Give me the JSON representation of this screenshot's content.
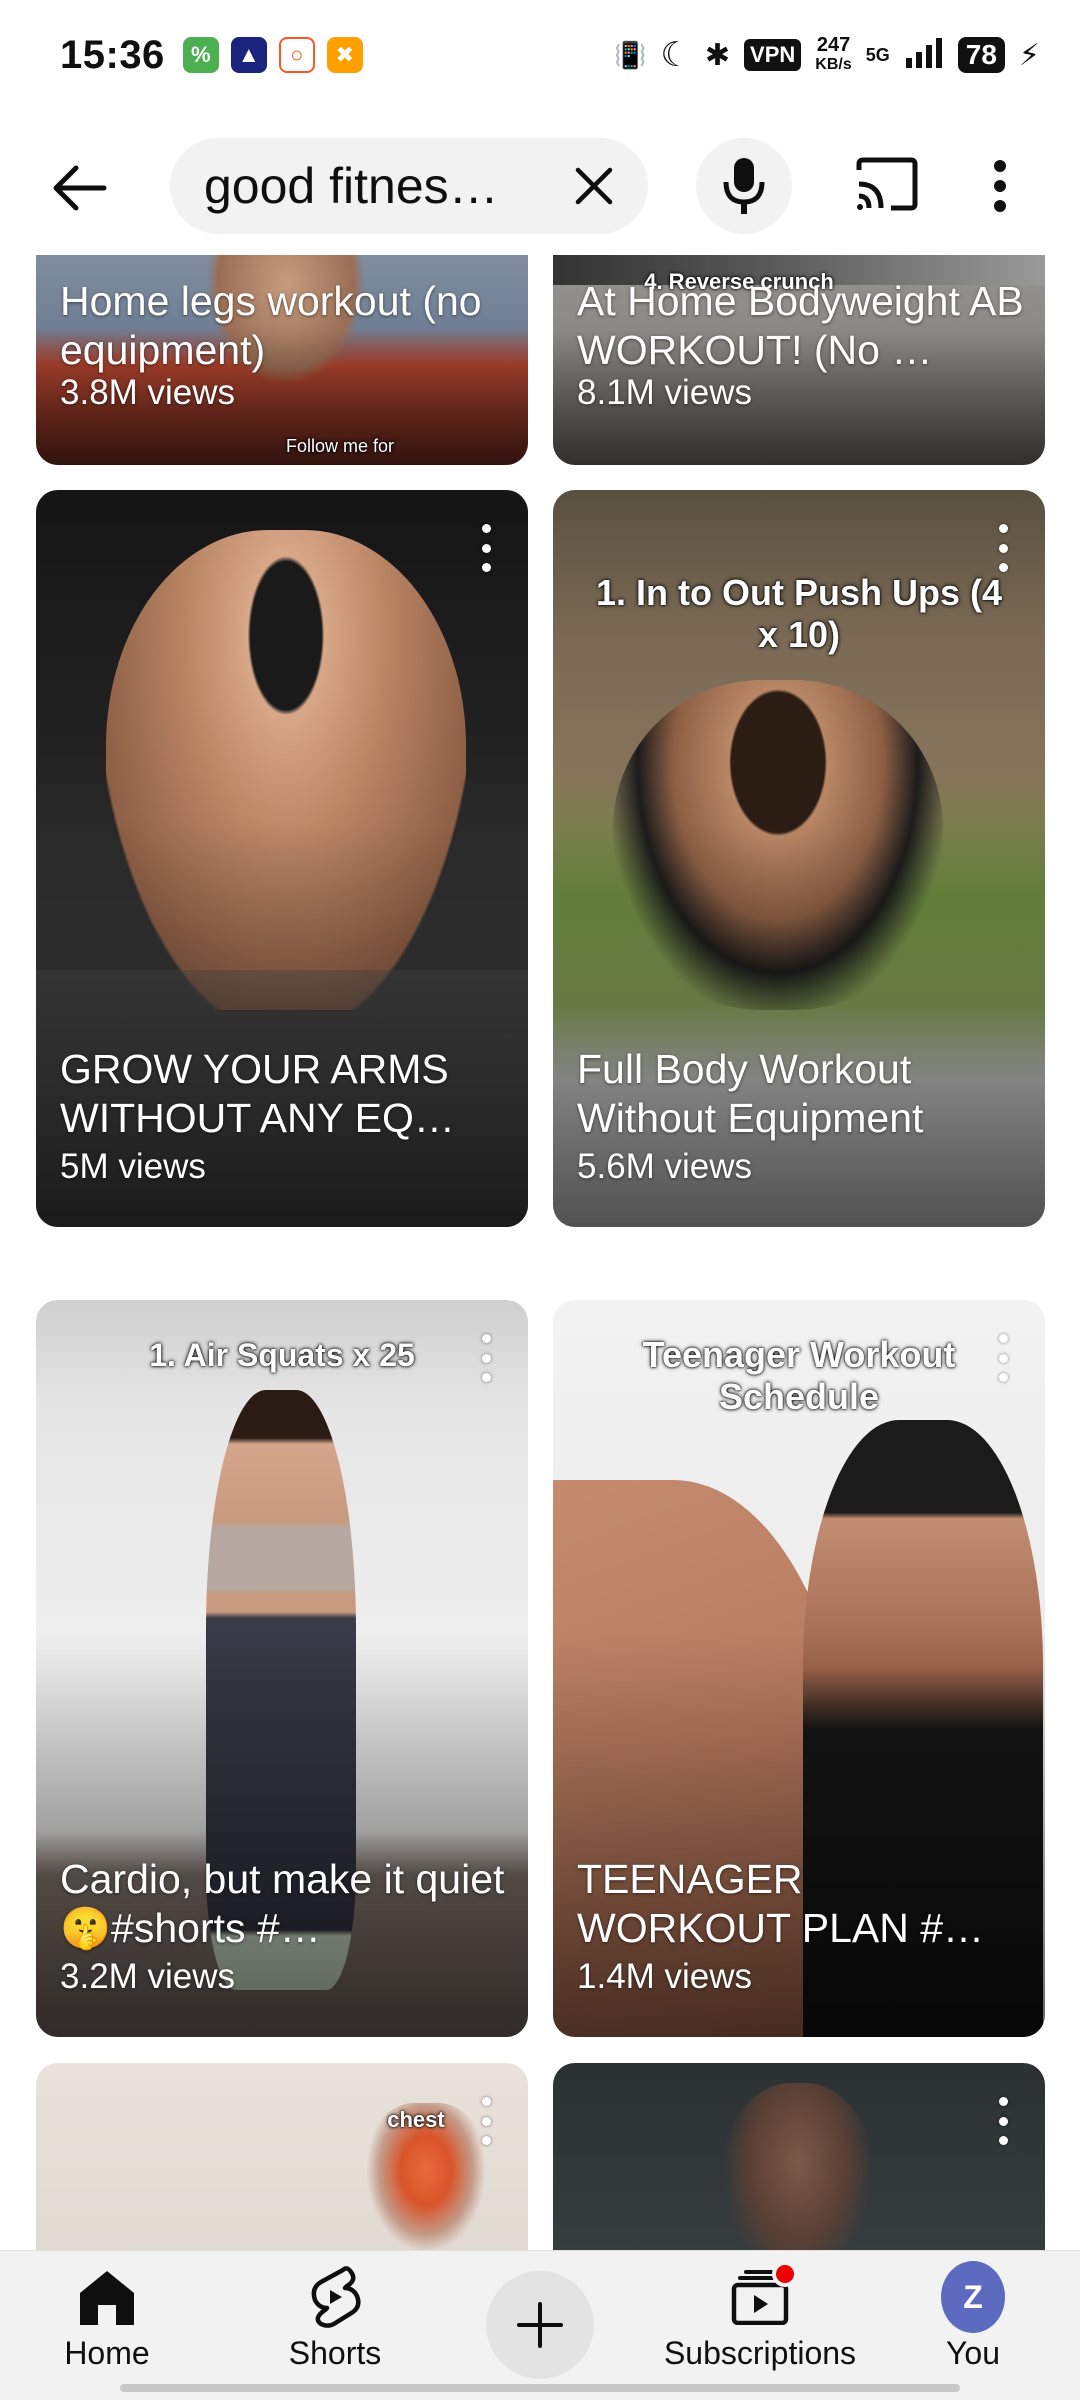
{
  "status_bar": {
    "time": "15:36",
    "vpn": "VPN",
    "speed_value": "247",
    "speed_unit": "KB/s",
    "network": "5G",
    "battery": "78"
  },
  "search": {
    "query": "good fitnes…",
    "back_icon": "back-arrow-icon",
    "clear_icon": "close-icon",
    "mic_icon": "microphone-icon",
    "cast_icon": "cast-icon",
    "more_icon": "more-vert-icon"
  },
  "videos": [
    {
      "title": "Home legs workout (no equipment)",
      "views": "3.8M views",
      "overlay": "Follow me for"
    },
    {
      "title": "At Home Bodyweight AB WORKOUT! (No …",
      "views": "8.1M views",
      "overlay": "4. Reverse crunch"
    },
    {
      "title": "GROW YOUR ARMS WITHOUT ANY EQ…",
      "views": "5M views",
      "overlay": ""
    },
    {
      "title": "Full Body Workout Without Equipment",
      "views": "5.6M views",
      "overlay": "1. In to Out Push Ups (4 x 10)"
    },
    {
      "title": "Cardio, but make it quiet 🤫#shorts #…",
      "views": "3.2M views",
      "overlay": "1. Air Squats x 25"
    },
    {
      "title": "TEENAGER WORKOUT PLAN #…",
      "views": "1.4M views",
      "overlay": "Teenager Workout Schedule"
    },
    {
      "title": "",
      "views": "",
      "overlay": "chest"
    },
    {
      "title": "",
      "views": "",
      "overlay": ""
    }
  ],
  "bottom_nav": {
    "home": "Home",
    "shorts": "Shorts",
    "subscriptions": "Subscriptions",
    "you": "You",
    "avatar_letter": "Z"
  },
  "colors": {
    "accent_red": "#ee0000",
    "avatar": "#5c6bc0",
    "surface": "#f2f2f2"
  }
}
